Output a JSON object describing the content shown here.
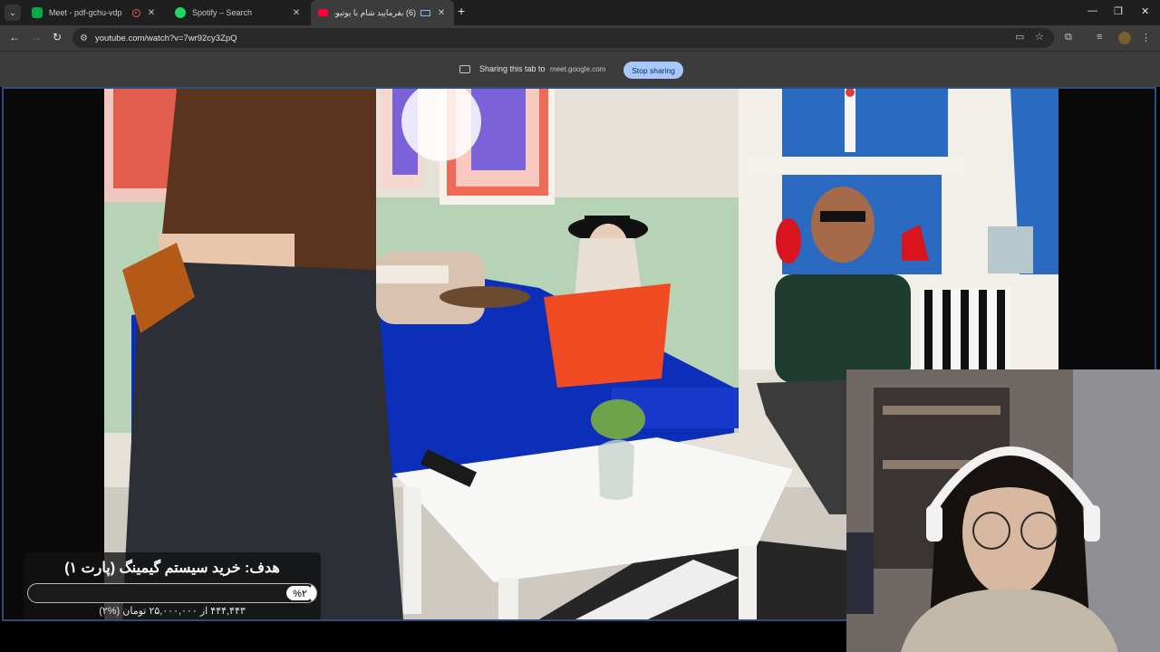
{
  "tabs": [
    {
      "title": "Meet - pdf-gchu-vdp",
      "favicon": "meet-icon",
      "recording": true
    },
    {
      "title": "Spotify – Search",
      "favicon": "spotify-icon"
    },
    {
      "title": "(6) بفرمایید شام با یوتیوبرا (...",
      "favicon": "youtube-icon",
      "active": true
    }
  ],
  "toolbar": {
    "url": "youtube.com/watch?v=7wr92cy3ZpQ"
  },
  "sharing": {
    "text": "Sharing this tab to",
    "host": "meet.google.com",
    "stop_label": "Stop sharing"
  },
  "goal": {
    "title": "هدف: خرید سیستم گیمینگ (پارت ۱)",
    "percent_label": "%۲",
    "progress": 0.02,
    "subtitle": "۴۴۴,۴۴۳ از ۲۵,۰۰۰,۰۰۰ تومان (%۲)"
  },
  "colors": {
    "tab_bg": "#1f1f1f",
    "toolbar_bg": "#3c3c3c",
    "stop_button": "#a8c7fa",
    "share_border": "#2d4f80"
  }
}
